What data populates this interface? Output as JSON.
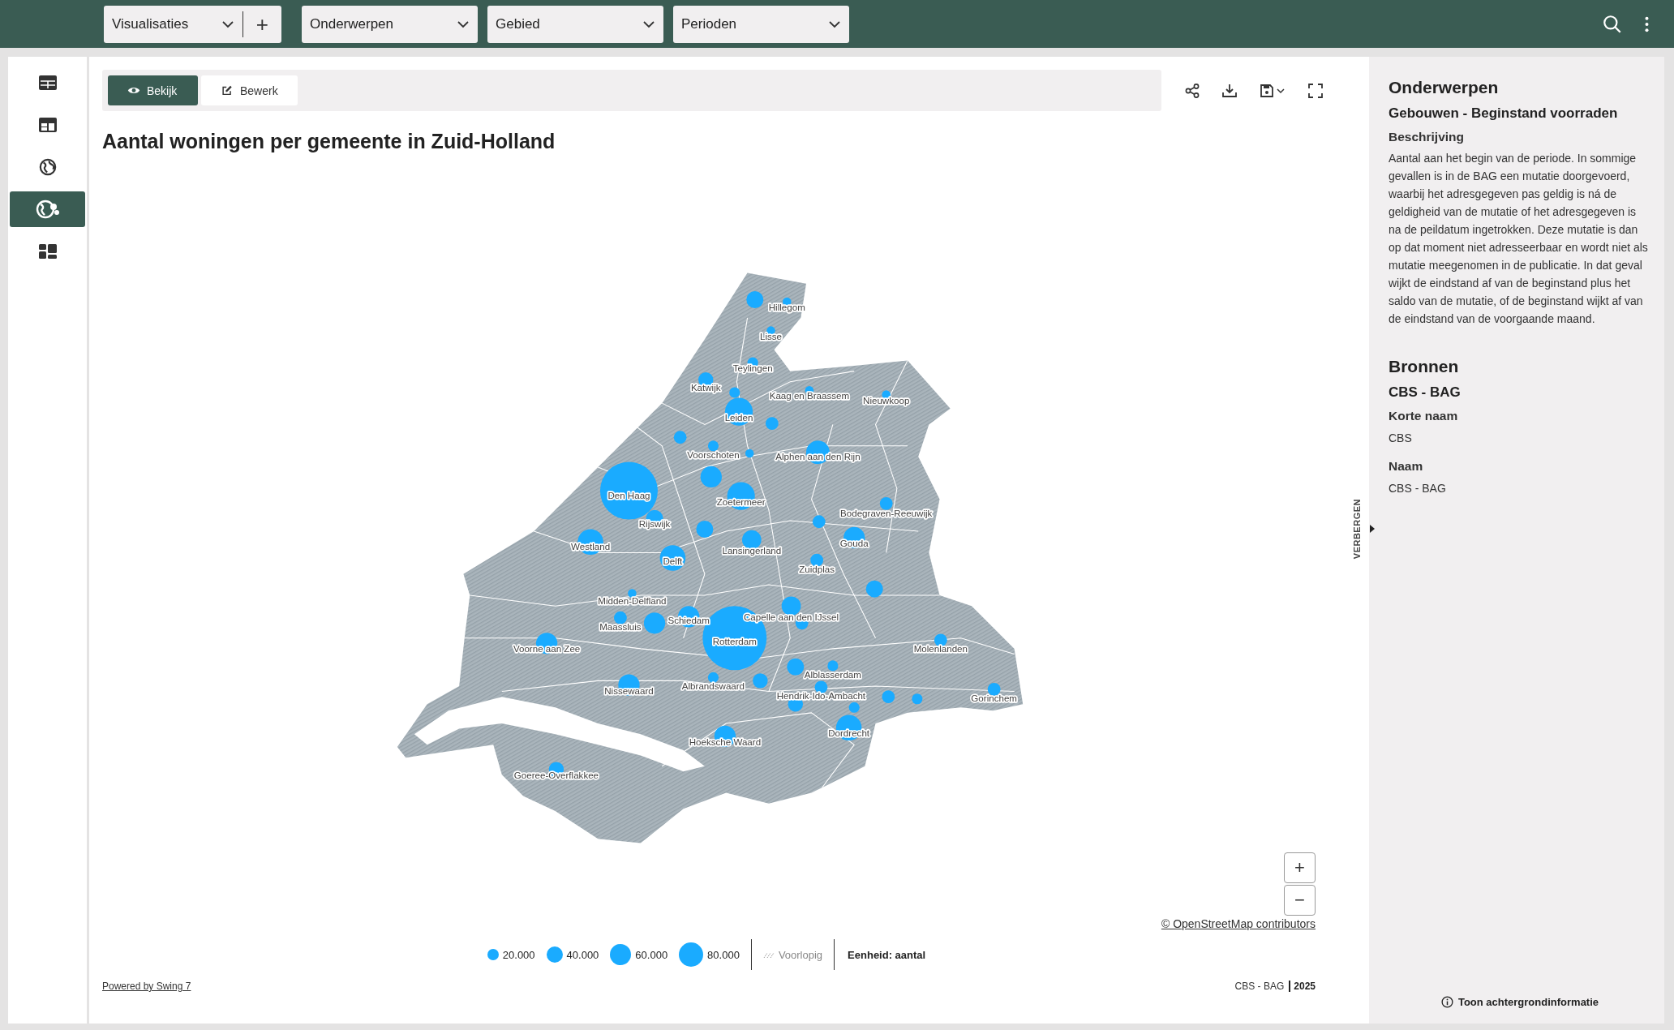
{
  "top_bar": {
    "visualisations": {
      "label": "Visualisaties",
      "add": "+"
    },
    "filters": [
      {
        "label": "Onderwerpen"
      },
      {
        "label": "Gebied"
      },
      {
        "label": "Perioden"
      }
    ]
  },
  "sidebar": {
    "items": [
      {
        "selected": false
      },
      {
        "selected": false
      },
      {
        "selected": false
      },
      {
        "selected": true
      },
      {
        "selected": false
      }
    ]
  },
  "mode_tabs": [
    {
      "label": "Bekijk",
      "selected": true
    },
    {
      "label": "Bewerk",
      "selected": false
    }
  ],
  "title": "Aantal woningen per gemeente in Zuid-Holland",
  "map": {
    "municipalities": [
      {
        "name": "Hillegom"
      },
      {
        "name": "Lisse"
      },
      {
        "name": "Teylingen"
      },
      {
        "name": "Katwijk"
      },
      {
        "name": "Kaag en Braassem"
      },
      {
        "name": "Nieuwkoop"
      },
      {
        "name": "Leiden"
      },
      {
        "name": "Voorschoten"
      },
      {
        "name": "Alphen aan den Rijn"
      },
      {
        "name": "Den Haag"
      },
      {
        "name": "Zoetermeer"
      },
      {
        "name": "Bodegraven-Reeuwijk"
      },
      {
        "name": "Rijswijk"
      },
      {
        "name": "Westland"
      },
      {
        "name": "Lansingerland"
      },
      {
        "name": "Gouda"
      },
      {
        "name": "Delft"
      },
      {
        "name": "Zuidplas"
      },
      {
        "name": "Midden-Delfland"
      },
      {
        "name": "Capelle aan den IJssel"
      },
      {
        "name": "Maassluis"
      },
      {
        "name": "Schiedam"
      },
      {
        "name": "Rotterdam"
      },
      {
        "name": "Voorne aan Zee"
      },
      {
        "name": "Molenlanden"
      },
      {
        "name": "Alblasserdam"
      },
      {
        "name": "Albrandswaard"
      },
      {
        "name": "Nissewaard"
      },
      {
        "name": "Hendrik-Ido-Ambacht"
      },
      {
        "name": "Gorinchem"
      },
      {
        "name": "Hoeksche Waard"
      },
      {
        "name": "Dordrecht"
      },
      {
        "name": "Goeree-Overflakkee"
      }
    ],
    "zoom_in": "+",
    "zoom_out": "−",
    "attribution": "© OpenStreetMap contributors"
  },
  "legend": {
    "sizes": [
      {
        "label": "20.000"
      },
      {
        "label": "40.000"
      },
      {
        "label": "60.000"
      },
      {
        "label": "80.000"
      }
    ],
    "provisional": "Voorlopig",
    "unit": "Eenheid: aantal"
  },
  "footer": {
    "powered_by": "Powered by Swing 7",
    "source": "CBS - BAG",
    "year": "2025"
  },
  "side_panel": {
    "toggle": "VERBERGEN",
    "heading": "Onderwerpen",
    "topic": "Gebouwen - Beginstand voorraden",
    "description_label": "Beschrijving",
    "description": "Aantal aan het begin van de periode. In sommige gevallen is in de BAG een mutatie doorgevoerd, waarbij het adresgegeven pas geldig is ná de geldigheid van de mutatie of het adresgegeven is na de peildatum ingetrokken. Deze mutatie is dan op dat moment niet adresseerbaar en wordt niet als mutatie meegenomen in de publicatie. In dat geval wijkt de eindstand af van de beginstand plus het saldo van de mutatie, of de beginstand wijkt af van de eindstand van de voorgaande maand.",
    "sources_heading": "Bronnen",
    "source_name": "CBS - BAG",
    "short_name_label": "Korte naam",
    "short_name": "CBS",
    "name_label": "Naam",
    "name": "CBS - BAG",
    "background_info": "Toon achtergrondinformatie"
  }
}
